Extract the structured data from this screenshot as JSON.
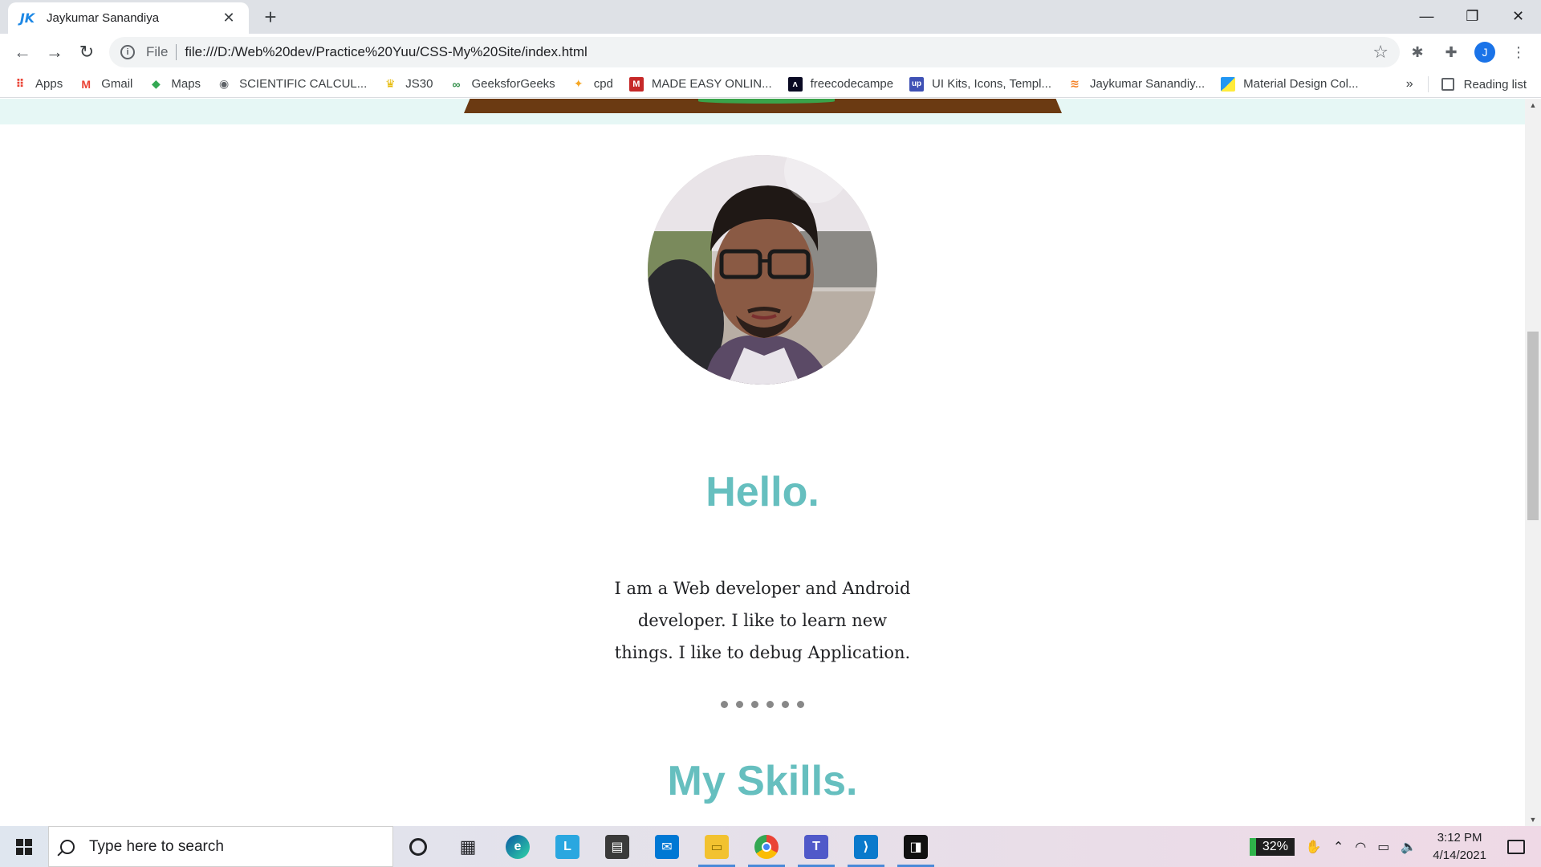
{
  "browser": {
    "tab": {
      "title": "Jaykumar Sanandiya",
      "favicon": "JK"
    },
    "omnibox": {
      "scheme": "File",
      "url": "file:///D:/Web%20dev/Practice%20Yuu/CSS-My%20Site/index.html"
    },
    "profile_initial": "J",
    "bookmarks": [
      {
        "label": "Apps",
        "icon": "apps-grid-icon",
        "color": "#ea4335"
      },
      {
        "label": "Gmail",
        "icon": "gmail-icon",
        "color": "#ea4335"
      },
      {
        "label": "Maps",
        "icon": "maps-icon",
        "color": "#34a853"
      },
      {
        "label": "SCIENTIFIC CALCUL...",
        "icon": "globe-icon",
        "color": "#5f6368"
      },
      {
        "label": "JS30",
        "icon": "crown-icon",
        "color": "#f5c518"
      },
      {
        "label": "GeeksforGeeks",
        "icon": "gfg-icon",
        "color": "#2f8d46"
      },
      {
        "label": "cpd",
        "icon": "cpd-icon",
        "color": "#f5a623"
      },
      {
        "label": "MADE EASY ONLIN...",
        "icon": "madeeasy-icon",
        "color": "#c62828"
      },
      {
        "label": "freecodecampe",
        "icon": "freecodecamp-icon",
        "color": "#0a0a23"
      },
      {
        "label": "UI Kits, Icons, Templ...",
        "icon": "upwork-icon",
        "color": "#3f51b5"
      },
      {
        "label": "Jaykumar Sanandiy...",
        "icon": "stackoverflow-icon",
        "color": "#f48024"
      },
      {
        "label": "Material Design Col...",
        "icon": "material-icon",
        "color": "#2196f3"
      }
    ],
    "more_bookmarks": "»",
    "reading_list": "Reading list"
  },
  "page": {
    "hello_heading": "Hello.",
    "intro_text": "I am a Web developer and Android developer. I like to learn new things. I like to debug Application.",
    "skills_heading": "My Skills.",
    "accent_color": "#66bfbf"
  },
  "taskbar": {
    "search_placeholder": "Type here to search",
    "battery": "32%",
    "time": "3:12 PM",
    "date": "4/14/2021"
  }
}
